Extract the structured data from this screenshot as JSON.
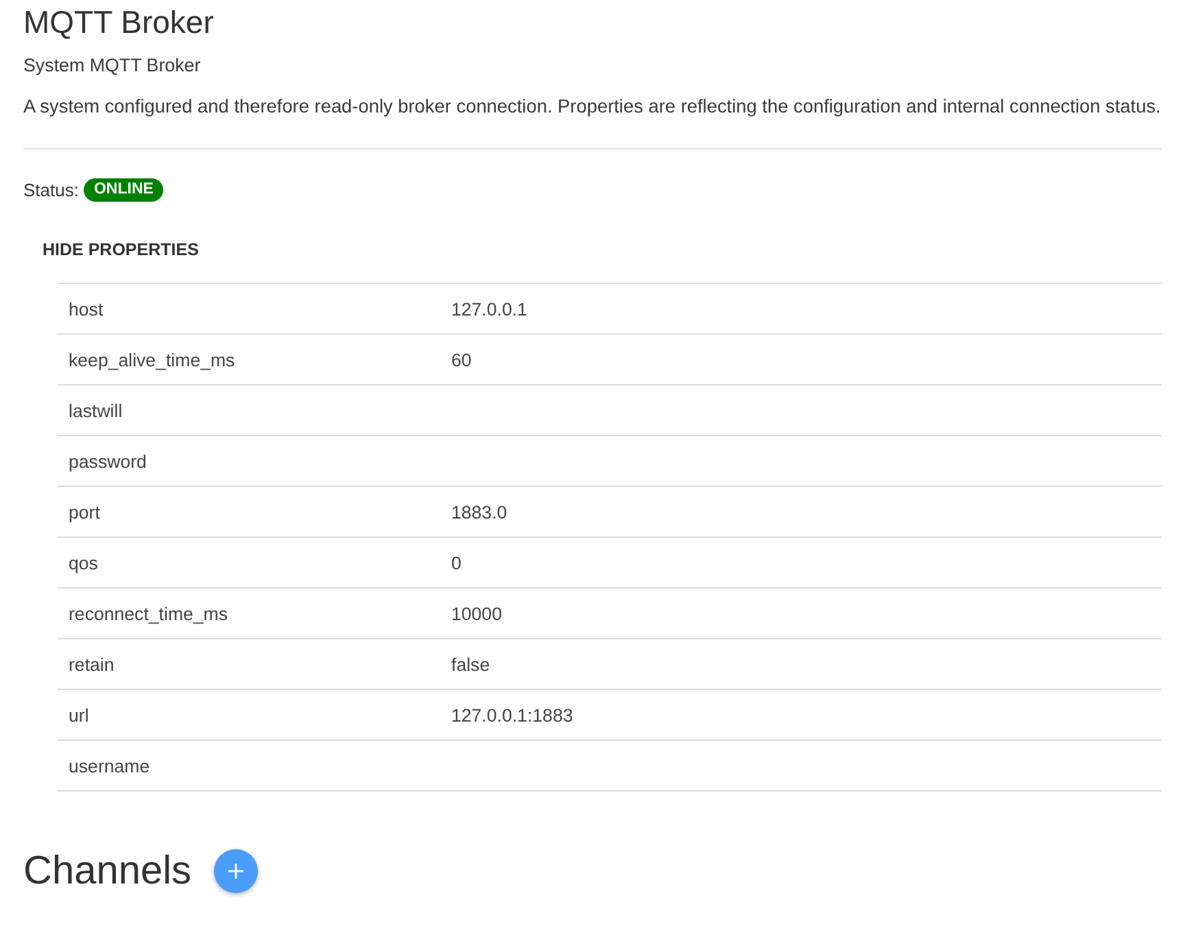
{
  "header": {
    "title": "MQTT Broker",
    "subtitle": "System MQTT Broker",
    "description": "A system configured and therefore read-only broker connection. Properties are reflecting the configuration and internal connection status."
  },
  "status": {
    "label": "Status:",
    "value": "ONLINE",
    "online": true
  },
  "properties": {
    "toggle_label": "HIDE PROPERTIES",
    "rows": [
      {
        "key": "host",
        "value": "127.0.0.1"
      },
      {
        "key": "keep_alive_time_ms",
        "value": "60"
      },
      {
        "key": "lastwill"
      },
      {
        "key": "password"
      },
      {
        "key": "port",
        "value": "1883.0"
      },
      {
        "key": "qos",
        "value": "0"
      },
      {
        "key": "reconnect_time_ms",
        "value": "10000"
      },
      {
        "key": "retain",
        "value": "false"
      },
      {
        "key": "url",
        "value": "127.0.0.1:1883"
      },
      {
        "key": "username"
      }
    ]
  },
  "channels": {
    "title": "Channels"
  }
}
